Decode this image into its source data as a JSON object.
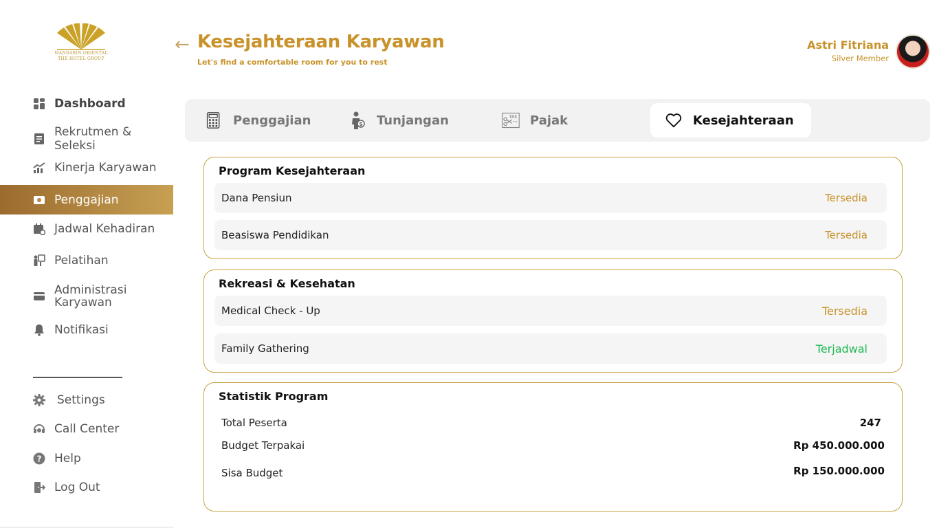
{
  "brand": {
    "line1": "MANDARIN ORIENTAL",
    "line2": "THE HOTEL GROUP"
  },
  "sidebar": {
    "items": [
      {
        "label": "Dashboard",
        "icon": "grid-icon"
      },
      {
        "label": "Rekrutmen & Seleksi",
        "icon": "document-icon"
      },
      {
        "label": "Kinerja Karyawan",
        "icon": "chart-icon"
      },
      {
        "label": "Penggajian",
        "icon": "money-icon"
      },
      {
        "label": "Jadwal Kehadiran",
        "icon": "calendar-icon"
      },
      {
        "label": "Pelatihan",
        "icon": "training-icon"
      },
      {
        "label": "Administrasi Karyawan",
        "icon": "card-icon"
      },
      {
        "label": "Notifikasi",
        "icon": "bell-icon"
      }
    ],
    "bottom": [
      {
        "label": "Settings",
        "icon": "gear-icon"
      },
      {
        "label": "Call Center",
        "icon": "headset-icon"
      },
      {
        "label": "Help",
        "icon": "help-icon"
      },
      {
        "label": "Log Out",
        "icon": "logout-icon"
      }
    ],
    "active_color": "#b98a43"
  },
  "header": {
    "title": "Kesejahteraan Karyawan",
    "subtitle": "Let's find a comfortable room for you to rest",
    "user_name": "Astri Fitriana",
    "user_tier": "Silver Member"
  },
  "tabs": [
    {
      "label": "Penggajian",
      "icon": "calculator-icon"
    },
    {
      "label": "Tunjangan",
      "icon": "person-money-icon"
    },
    {
      "label": "Pajak",
      "icon": "tax-icon"
    },
    {
      "label": "Kesejahteraan",
      "icon": "heart-icon"
    }
  ],
  "program": {
    "title": "Program Kesejahteraan",
    "rows": [
      {
        "label": "Dana Pensiun",
        "status": "Tersedia"
      },
      {
        "label": "Beasiswa Pendidikan",
        "status": "Tersedia"
      }
    ]
  },
  "rekreasi": {
    "title": "Rekreasi & Kesehatan",
    "rows": [
      {
        "label": "Medical Check - Up",
        "status": "Tersedia"
      },
      {
        "label": "Family Gathering",
        "status": "Terjadwal"
      }
    ]
  },
  "statistik": {
    "title": "Statistik Program",
    "rows": [
      {
        "label": "Total Peserta",
        "value": "247"
      },
      {
        "label": "Budget Terpakai",
        "value": "Rp 450.000.000"
      },
      {
        "label": "Sisa Budget",
        "value": "Rp 150.000.000"
      }
    ]
  },
  "colors": {
    "gold": "#c8922a",
    "available": "#c8922a",
    "scheduled": "#1db954"
  }
}
